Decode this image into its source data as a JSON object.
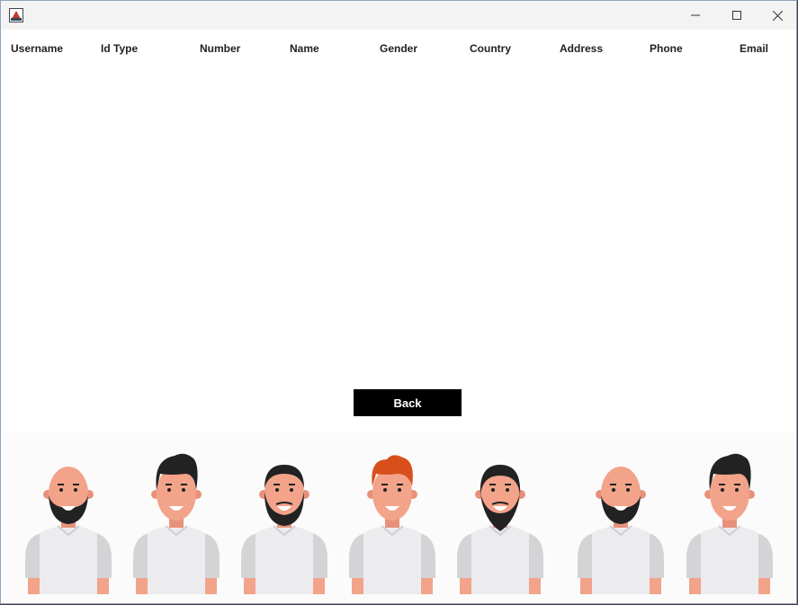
{
  "window": {
    "title": "",
    "controls": [
      "minimize-icon",
      "maximize-icon",
      "close-icon"
    ]
  },
  "table": {
    "columns": [
      "Username",
      "Id Type",
      "Number",
      "Name",
      "Gender",
      "Country",
      "Address",
      "Phone",
      "Email"
    ],
    "rows": []
  },
  "actions": {
    "back_label": "Back"
  },
  "illustration": {
    "people": [
      {
        "hair": "bald",
        "beard": "full"
      },
      {
        "hair": "quiff",
        "beard": "none"
      },
      {
        "hair": "short",
        "beard": "goatee"
      },
      {
        "hair": "red-quiff",
        "beard": "none"
      },
      {
        "hair": "long",
        "beard": "pointed"
      },
      {
        "hair": "bald",
        "beard": "full"
      },
      {
        "hair": "quiff",
        "beard": "none"
      }
    ],
    "colors": {
      "skin": "#f2a38a",
      "ear": "#e8917a",
      "shirt": "#ececee",
      "sleeve": "#d4d4d6",
      "dark_hair": "#222222",
      "red_hair": "#d94f1c"
    }
  }
}
